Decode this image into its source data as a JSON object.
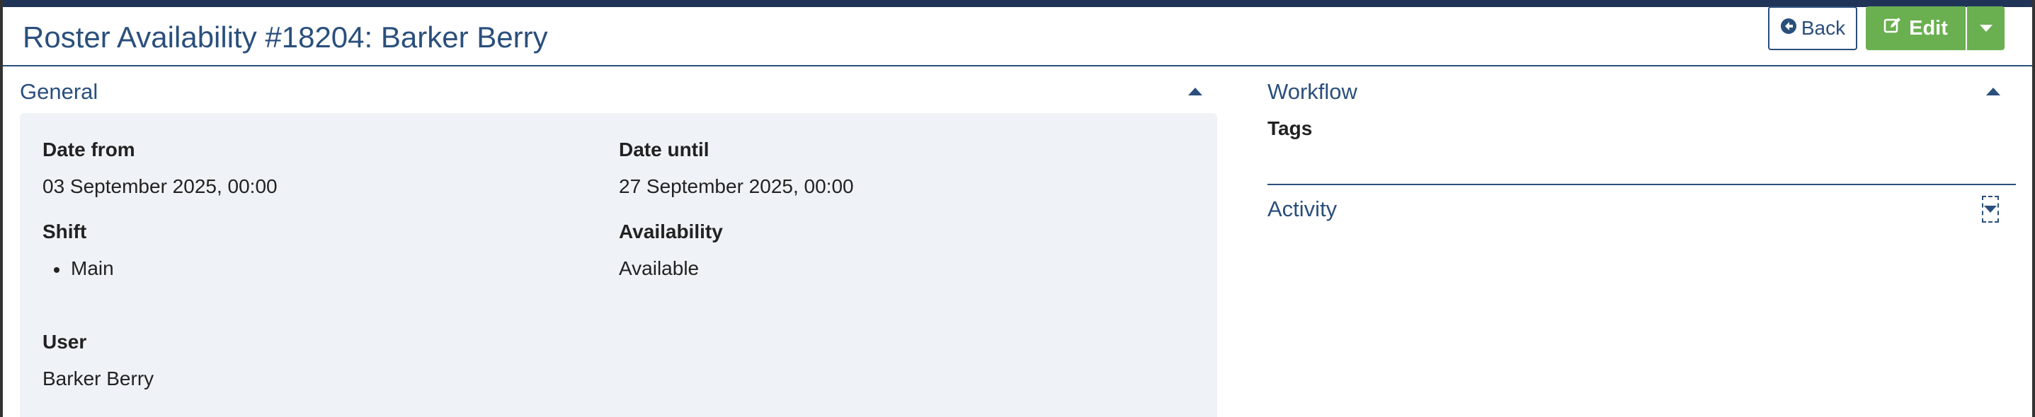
{
  "page": {
    "title": "Roster Availability #18204: Barker Berry"
  },
  "toolbar": {
    "back_label": "Back",
    "edit_label": "Edit"
  },
  "general": {
    "heading": "General",
    "date_from_label": "Date from",
    "date_from_value": "03 September 2025, 00:00",
    "date_until_label": "Date until",
    "date_until_value": "27 September 2025, 00:00",
    "shift_label": "Shift",
    "shift_items": [
      "Main"
    ],
    "availability_label": "Availability",
    "availability_value": "Available",
    "user_label": "User",
    "user_value": "Barker Berry"
  },
  "workflow": {
    "heading": "Workflow",
    "tags_label": "Tags"
  },
  "activity": {
    "heading": "Activity"
  },
  "colors": {
    "accent": "#2a4f7c",
    "edit_button": "#6aaf50",
    "panel_background": "#eff3f7"
  },
  "icons": {
    "back": "circle-arrow-left-icon",
    "edit": "pencil-square-icon",
    "dropdown": "caret-down-icon",
    "collapse": "caret-up-icon",
    "expand": "caret-down-icon"
  }
}
